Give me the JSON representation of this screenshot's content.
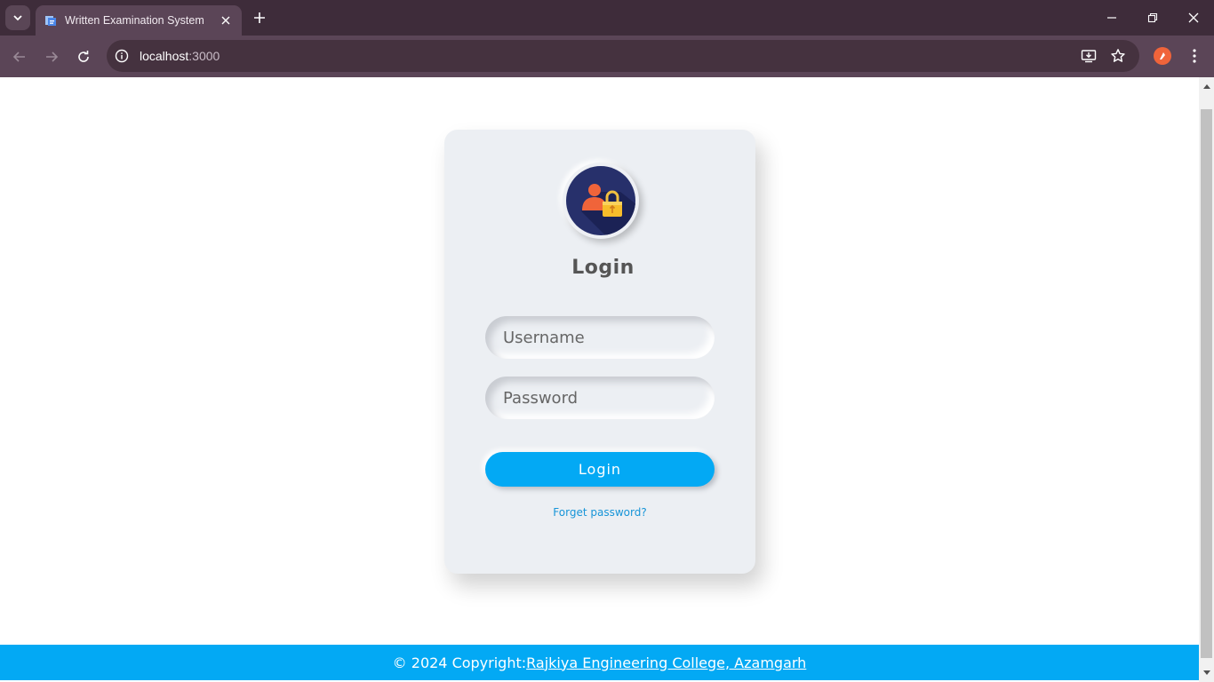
{
  "browser": {
    "tab": {
      "title": "Written Examination System"
    },
    "address": {
      "host": "localhost",
      "port": ":3000"
    }
  },
  "login": {
    "title": "Login",
    "username_placeholder": "Username",
    "password_placeholder": "Password",
    "button_label": "Login",
    "forgot_label": "Forget password?"
  },
  "footer": {
    "copyright": "© 2024 Copyright:",
    "org_link": " Rajkiya Engineering College, Azamgarh"
  },
  "colors": {
    "accent": "#03a9f4",
    "logo_dark": "#27306b",
    "logo_person": "#f0643a",
    "lock": "#f7bd2b"
  }
}
